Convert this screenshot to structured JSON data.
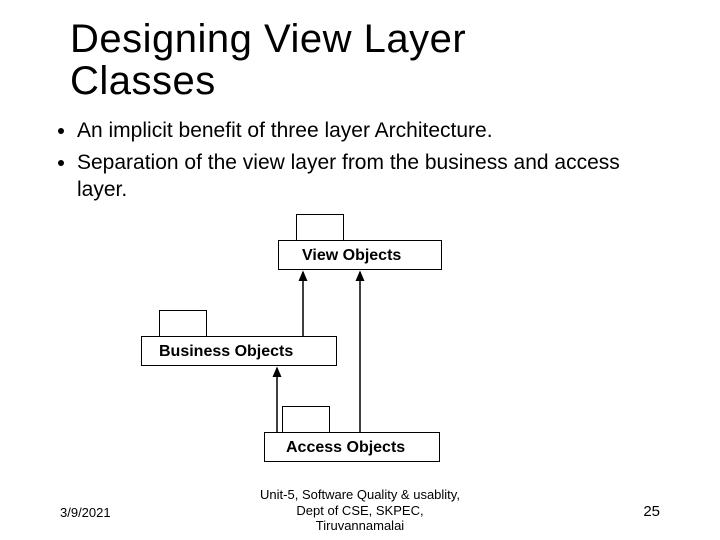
{
  "title_line1": "Designing View Layer",
  "title_line2": "Classes",
  "bullets": {
    "b1": "An implicit benefit of three layer Architecture.",
    "b2": "Separation of the view layer from the business and access layer."
  },
  "diagram": {
    "view_label": "View Objects",
    "business_label": "Business Objects",
    "access_label": "Access Objects"
  },
  "footer": {
    "date": "3/9/2021",
    "center_l1": "Unit-5, Software Quality & usablity,",
    "center_l2": "Dept of CSE, SKPEC,",
    "center_l3": "Tiruvannamalai",
    "page": "25"
  }
}
